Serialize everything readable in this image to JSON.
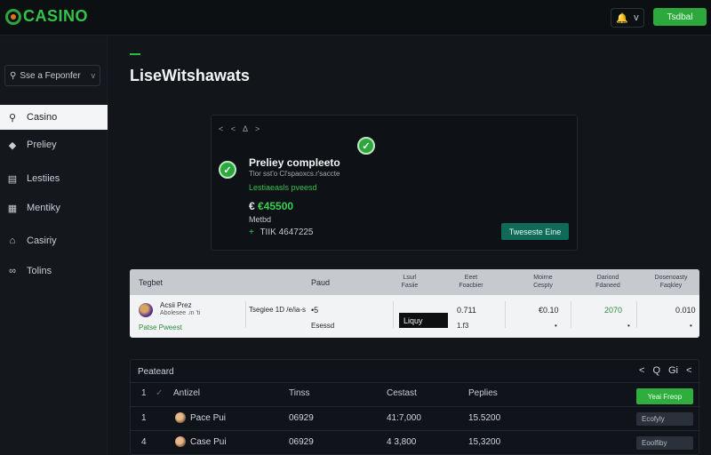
{
  "brand": {
    "name": "CASINO"
  },
  "topbar": {
    "bell_icon": "bell-icon",
    "caret": "v",
    "action_label": "Tsdbal"
  },
  "sidebar": {
    "search_placeholder": "Sse a Feponfer",
    "search_caret": "v",
    "items": [
      {
        "label": "Casino",
        "icon": "search-icon",
        "active": true
      },
      {
        "label": "Preliey",
        "icon": "tag-icon",
        "active": false
      },
      {
        "label": "Lestiies",
        "icon": "list-icon",
        "active": false
      },
      {
        "label": "Mentiky",
        "icon": "grid-icon",
        "active": false
      },
      {
        "label": "Casiriy",
        "icon": "home-icon",
        "active": false
      },
      {
        "label": "Tolins",
        "icon": "link-icon",
        "active": false
      }
    ]
  },
  "main": {
    "title": "LiseWitshawats"
  },
  "card": {
    "nav": "< < Δ >",
    "title": "Preliey compleeto",
    "subtitle": "Tlor sst'o Cl'spaoxcs.r'saccte",
    "green_text": "Lestiaeasls pveesd",
    "currency": "€",
    "amount": "€45500",
    "method": "Metbd",
    "tx_arrow": "+",
    "tx": "TIIK 4647225",
    "button": "Tweseste Eine"
  },
  "bet_table": {
    "headers": [
      {
        "text": "Tegbet"
      },
      {
        "text": "Paud"
      },
      {
        "text": "Lsurl Fasiie"
      },
      {
        "text": "Eeet Foacbier"
      },
      {
        "text": "Moirne Cespty"
      },
      {
        "text": "Dariond Fdaneed"
      },
      {
        "text": "Dosenoasty Faqkley"
      }
    ],
    "row": {
      "name": "Acsii Prez",
      "sub": "Abolesee .in 'ti",
      "link": "Patse Pweest",
      "selection": "Tsegiee 1D /e/ia-s",
      "sel_value": "•5",
      "sel_value2": "Esessd",
      "black_label": "Liquy",
      "c4": "0.711",
      "c4b": "1.f3",
      "c5": "€0.10",
      "c5b": "•",
      "c6": "2070",
      "c6b": "•",
      "c7": "0.010",
      "c7b": "•"
    }
  },
  "panel": {
    "title": "Peateard",
    "ctrls": [
      "<",
      "Q",
      "Gi",
      "<"
    ],
    "headers": {
      "num": "1",
      "check": "✓",
      "col1": "Antizel",
      "col2": "Tinss",
      "col3": "Cestast",
      "col4": "Peplies"
    },
    "action": "Yeai Freop",
    "rows": [
      {
        "num": "1",
        "name": "Pace Pui",
        "time": "06929",
        "c3": "41:7,000",
        "c4": "15.5200",
        "btn": "Ecofyly"
      },
      {
        "num": "4",
        "name": "Case Pui",
        "time": "06929",
        "c3": "4 3,800",
        "c4": "15,3200",
        "btn": "Eoolfiby"
      }
    ]
  },
  "colors": {
    "accent": "#2da83c",
    "teal": "#0f6a57",
    "background": "#12151a"
  }
}
